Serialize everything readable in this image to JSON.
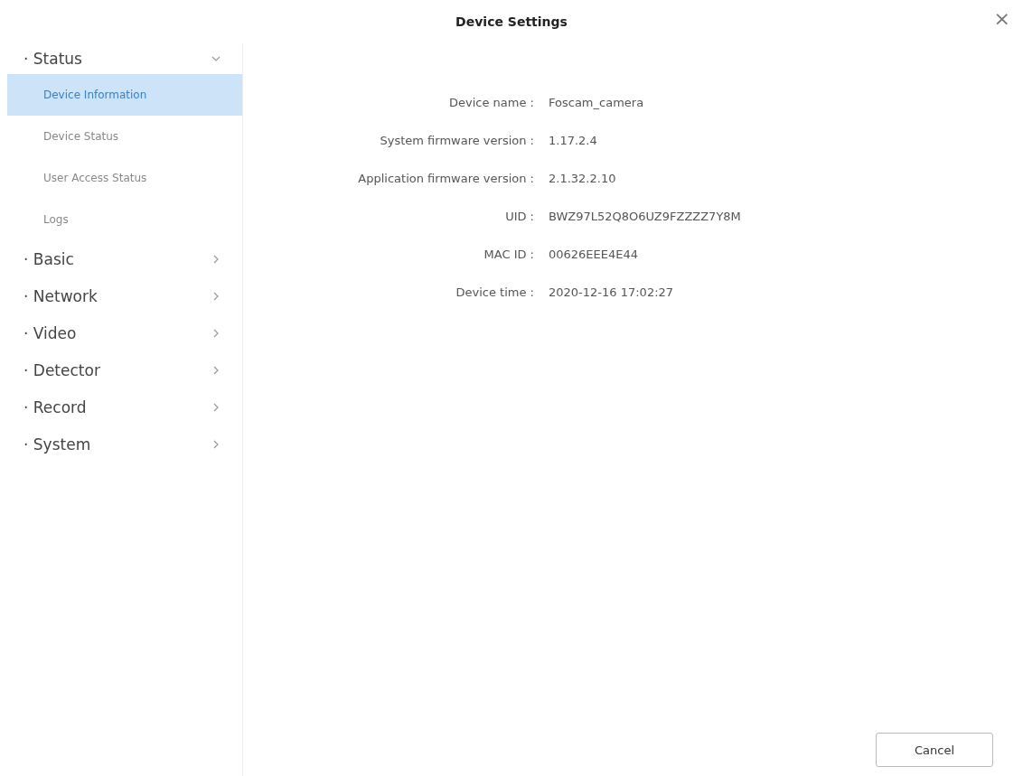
{
  "window": {
    "title": "Device Settings",
    "close": "×"
  },
  "sidebar": {
    "sections": [
      {
        "label": "· Status",
        "expanded": true,
        "items": [
          {
            "label": "Device Information",
            "selected": true
          },
          {
            "label": "Device Status",
            "selected": false
          },
          {
            "label": "User Access Status",
            "selected": false
          },
          {
            "label": "Logs",
            "selected": false
          }
        ]
      },
      {
        "label": "· Basic",
        "expanded": false
      },
      {
        "label": "· Network",
        "expanded": false
      },
      {
        "label": "· Video",
        "expanded": false
      },
      {
        "label": "· Detector",
        "expanded": false
      },
      {
        "label": "· Record",
        "expanded": false
      },
      {
        "label": "· System",
        "expanded": false
      }
    ]
  },
  "fields": [
    {
      "label": "Device name :",
      "value": "Foscam_camera"
    },
    {
      "label": "System firmware version :",
      "value": "1.17.2.4"
    },
    {
      "label": "Application firmware version :",
      "value": "2.1.32.2.10"
    },
    {
      "label": "UID :",
      "value": "BWZ97L52Q8O6UZ9FZZZZ7Y8M"
    },
    {
      "label": "MAC ID :",
      "value": "00626EEE4E44"
    },
    {
      "label": "Device time :",
      "value": "2020-12-16 17:02:27"
    }
  ],
  "buttons": [
    {
      "label": "Cancel"
    }
  ]
}
